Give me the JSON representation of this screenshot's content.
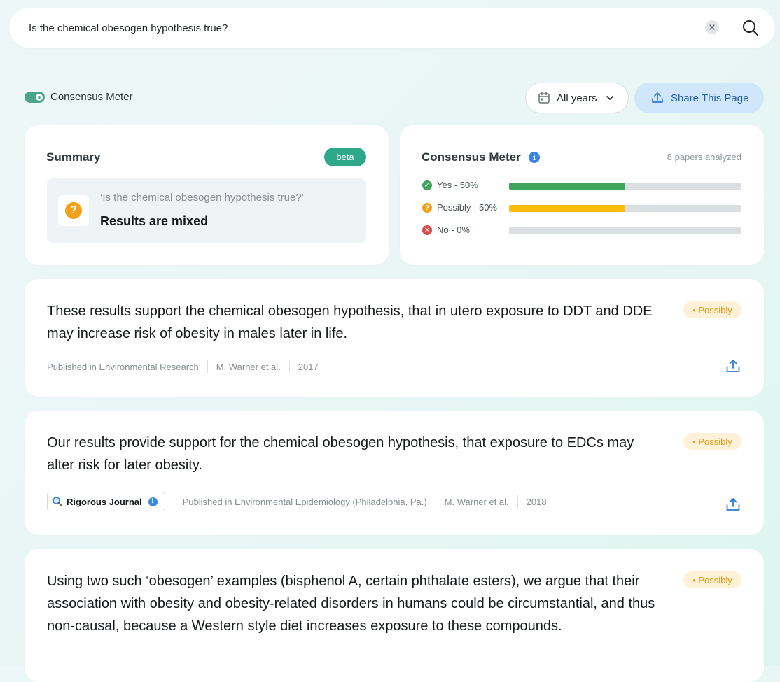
{
  "search": {
    "value": "Is the chemical obesogen hypothesis true?",
    "placeholder": ""
  },
  "toolbar": {
    "consensus_toggle_label": "Consensus Meter",
    "consensus_toggle_on": true,
    "years_filter": "All years",
    "share_label": "Share This Page"
  },
  "summary": {
    "title": "Summary",
    "badge": "beta",
    "question": "‘Is the chemical obesogen hypothesis true?’",
    "result": "Results are mixed",
    "icon": "question-icon"
  },
  "meter": {
    "title": "Consensus Meter",
    "papers": "8 papers analyzed",
    "rows": [
      {
        "label": "Yes - 50%",
        "percent": 50,
        "color": "#3ea55a",
        "icon": "check-icon",
        "icon_color": "#3ea55a"
      },
      {
        "label": "Possibly - 50%",
        "percent": 50,
        "color": "#fbbc0e",
        "icon": "question-icon",
        "icon_color": "#f3a01b"
      },
      {
        "label": "No - 0%",
        "percent": 0,
        "color": "#dc4a4a",
        "icon": "x-icon",
        "icon_color": "#dc4a4a"
      }
    ]
  },
  "results": [
    {
      "text": "These results support the chemical obesogen hypothesis, that in utero exposure to DDT and DDE may increase risk of obesity in males later in life.",
      "badge": "• Possibly",
      "journal": "Published in Environmental Research",
      "authors": "M. Warner et al.",
      "year": "2017"
    },
    {
      "text": "Our results provide support for the chemical obesogen hypothesis, that exposure to EDCs may alter risk for later obesity.",
      "badge": "• Possibly",
      "chip": "Rigorous Journal",
      "journal": "Published in Environmental Epidemiology (Philadelphia, Pa.)",
      "authors": "M. Warner et al.",
      "year": "2018"
    },
    {
      "text": "Using two such ‘obesogen’ examples (bisphenol A, certain phthalate esters), we argue that their association with obesity and obesity-related disorders in humans could be circumstantial, and thus non-causal, because a Western style diet increases exposure to these compounds.",
      "badge": "• Possibly"
    }
  ]
}
